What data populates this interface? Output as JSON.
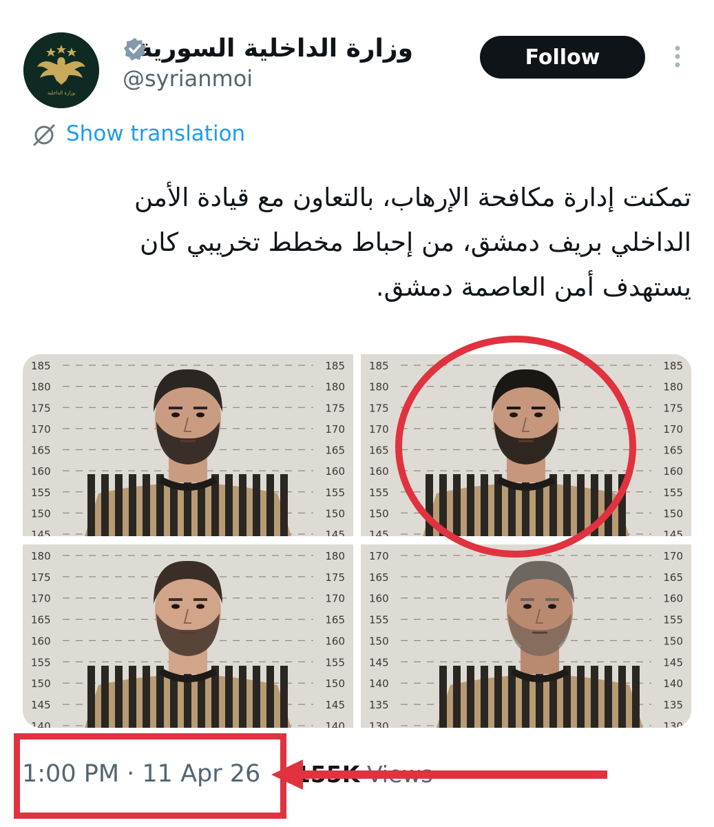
{
  "account": {
    "display_name": "وزارة الداخلية السورية",
    "handle": "@syrianmoi",
    "avatar_text": "وزارة الداخلية"
  },
  "actions": {
    "follow_label": "Follow",
    "more_icon": "more-vertical-icon"
  },
  "translation": {
    "label": "Show translation",
    "icon": "translate-icon"
  },
  "tweet": {
    "text": "تمكنت إدارة مكافحة الإرهاب، بالتعاون مع قيادة الأمن الداخلي بريف دمشق، من إحباط مخطط تخريبي كان يستهدف أمن العاصمة دمشق."
  },
  "media": {
    "photos": [
      {
        "scale_left": [
          "185",
          "180",
          "175",
          "170",
          "165",
          "160",
          "155",
          "150",
          "145"
        ],
        "scale_right": [
          "185",
          "180",
          "175",
          "170",
          "165",
          "160",
          "155",
          "150",
          "145"
        ]
      },
      {
        "scale_left": [
          "185",
          "180",
          "175",
          "170",
          "165",
          "160",
          "155",
          "150",
          "145"
        ],
        "scale_right": [
          "185",
          "180",
          "175",
          "170",
          "165",
          "160",
          "155",
          "150",
          "145"
        ]
      },
      {
        "scale_left": [
          "180",
          "175",
          "170",
          "165",
          "160",
          "155",
          "150",
          "145",
          "140"
        ],
        "scale_right": [
          "180",
          "175",
          "170",
          "165",
          "160",
          "155",
          "150",
          "145",
          "140"
        ]
      },
      {
        "scale_left": [
          "170",
          "165",
          "160",
          "155",
          "150",
          "145",
          "140",
          "135",
          "130"
        ],
        "scale_right": [
          "170",
          "165",
          "160",
          "155",
          "150",
          "145",
          "140",
          "135",
          "130"
        ]
      }
    ]
  },
  "meta": {
    "timestamp": "1:00 PM · 11 Apr 26",
    "views_count": "155K",
    "views_label": " Views"
  },
  "colors": {
    "accent_link": "#1d9bf0",
    "annotation_red": "#e0323f",
    "follow_bg": "#0f1419",
    "muted_text": "#536471"
  }
}
